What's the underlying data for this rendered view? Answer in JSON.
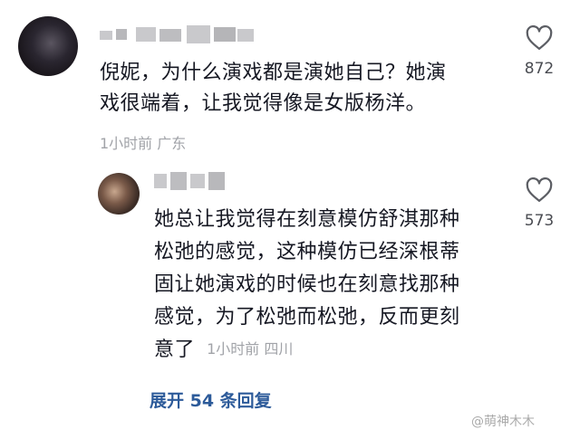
{
  "comments": [
    {
      "text_line1": "倪妮，为什么演戏都是演她自己？她演",
      "text_line2": "戏很端着，让我觉得像是女版杨洋。",
      "meta": "1小时前  广东",
      "likes": "872",
      "heart_icon": "heart-outline-icon"
    }
  ],
  "reply": {
    "lines": [
      "她总让我觉得在刻意模仿舒淇那种",
      "松弛的感觉，这种模仿已经深根蒂",
      "固让她演戏的时候也在刻意找那种",
      "感觉，为了松弛而松弛，反而更刻"
    ],
    "last_line": "意了",
    "meta": "1小时前  四川",
    "likes": "573",
    "heart_icon": "heart-outline-icon"
  },
  "expand_label": "展开 54 条回复",
  "watermark": "@萌神木木",
  "colors": {
    "link": "#2d5b9a",
    "meta": "#a1a3a8",
    "text": "#161823"
  }
}
